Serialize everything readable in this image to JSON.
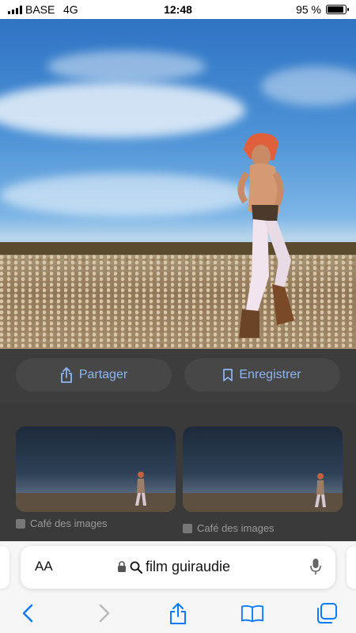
{
  "status_bar": {
    "carrier": "BASE",
    "network": "4G",
    "time": "12:48",
    "battery_percent": "95 %",
    "battery_level": 0.95
  },
  "actions": {
    "share_label": "Partager",
    "save_label": "Enregistrer"
  },
  "results": [
    {
      "source": "Café des images"
    },
    {
      "source": "Café des images"
    }
  ],
  "address_bar": {
    "text_size_label": "AA",
    "query": "film guiraudie"
  },
  "icons": {
    "share": "share-icon",
    "bookmark": "bookmark-icon",
    "lock": "lock-icon",
    "search": "search-icon",
    "mic": "mic-icon",
    "back": "back-icon",
    "forward": "forward-icon",
    "toolbar_share": "share-icon",
    "bookmarks": "book-icon",
    "tabs": "tabs-icon"
  },
  "colors": {
    "accent": "#0a7aff",
    "accent_dimmed": "#8eb6f3",
    "overlay": "#3d3d3d"
  }
}
